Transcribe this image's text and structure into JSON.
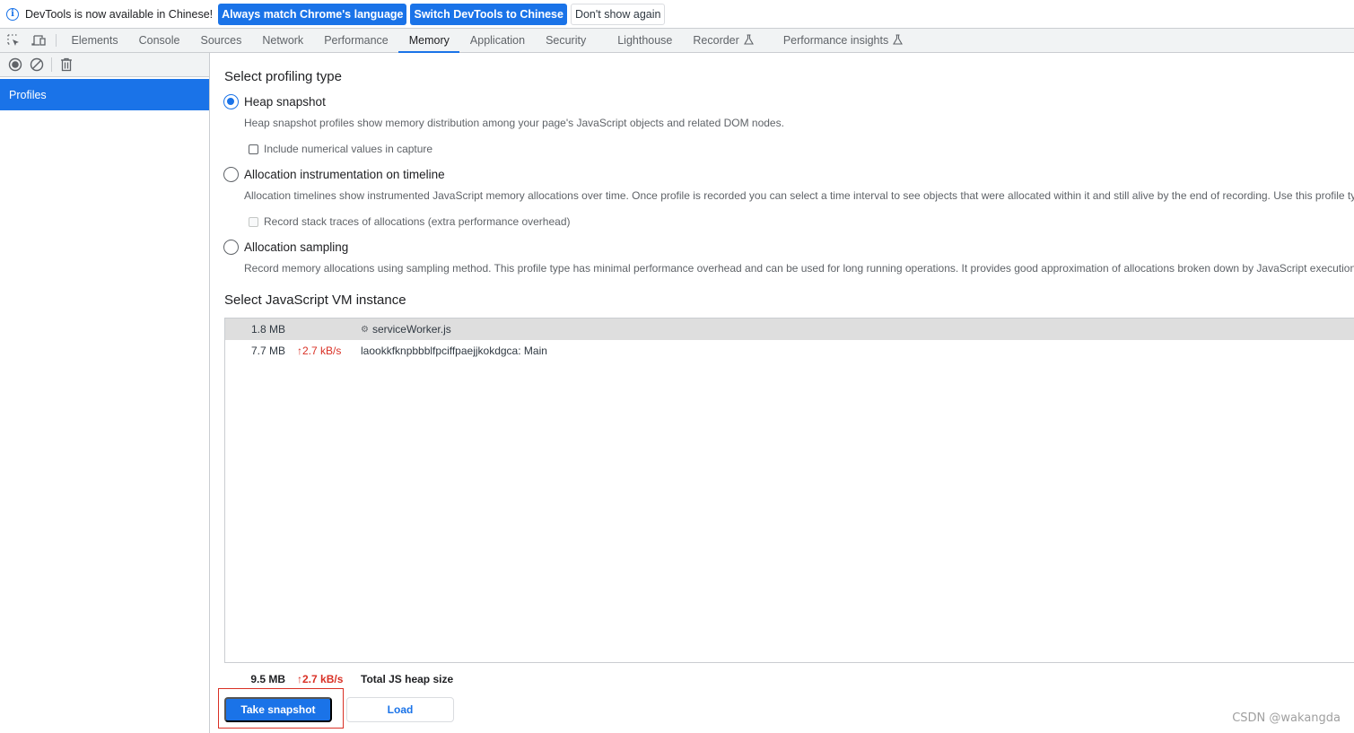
{
  "infobar": {
    "message": "DevTools is now available in Chinese!",
    "buttons": [
      {
        "label": "Always match Chrome's language"
      },
      {
        "label": "Switch DevTools to Chinese"
      },
      {
        "label": "Don't show again"
      }
    ]
  },
  "tabs": [
    {
      "label": "Elements"
    },
    {
      "label": "Console"
    },
    {
      "label": "Sources"
    },
    {
      "label": "Network"
    },
    {
      "label": "Performance"
    },
    {
      "label": "Memory",
      "active": true
    },
    {
      "label": "Application"
    },
    {
      "label": "Security"
    },
    {
      "label": "Lighthouse"
    },
    {
      "label": "Recorder",
      "experimental": true
    },
    {
      "label": "Performance insights",
      "experimental": true
    }
  ],
  "sidebar": {
    "items": [
      {
        "label": "Profiles",
        "selected": true
      }
    ]
  },
  "profiling": {
    "title": "Select profiling type",
    "options": [
      {
        "label": "Heap snapshot",
        "checked": true,
        "description": "Heap snapshot profiles show memory distribution among your page's JavaScript objects and related DOM nodes.",
        "checkbox": {
          "label": "Include numerical values in capture",
          "checked": false,
          "disabled": false
        }
      },
      {
        "label": "Allocation instrumentation on timeline",
        "checked": false,
        "description": "Allocation timelines show instrumented JavaScript memory allocations over time. Once profile is recorded you can select a time interval to see objects that were allocated within it and still alive by the end of recording. Use this profile ty",
        "checkbox": {
          "label": "Record stack traces of allocations (extra performance overhead)",
          "checked": false,
          "disabled": true
        }
      },
      {
        "label": "Allocation sampling",
        "checked": false,
        "description": "Record memory allocations using sampling method. This profile type has minimal performance overhead and can be used for long running operations. It provides good approximation of allocations broken down by JavaScript execution"
      }
    ]
  },
  "vm": {
    "title": "Select JavaScript VM instance",
    "instances": [
      {
        "size": "1.8 MB",
        "rate": "",
        "name": "serviceWorker.js",
        "icon": "gear-icon",
        "selected": true
      },
      {
        "size": "7.7 MB",
        "rate": "↑2.7 kB/s",
        "name": "laookkfknpbbblfpciffpaejjkokdgca: Main",
        "selected": false
      }
    ],
    "total": {
      "size": "9.5 MB",
      "rate": "↑2.7 kB/s",
      "label": "Total JS heap size"
    }
  },
  "actions": {
    "take_snapshot": "Take snapshot",
    "load": "Load"
  },
  "colors": {
    "accent": "#1a73e8",
    "rate_red": "#d93025",
    "highlight_box": "#d93025"
  },
  "watermark": "CSDN @wakangda"
}
